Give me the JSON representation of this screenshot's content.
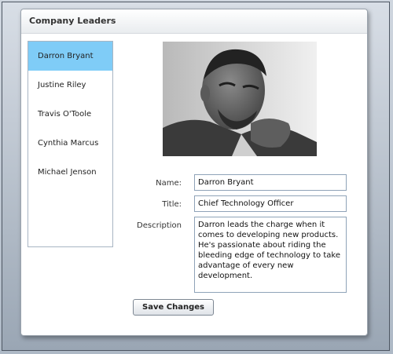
{
  "panel": {
    "title": "Company Leaders"
  },
  "leaders": [
    {
      "name": "Darron Bryant",
      "selected": true
    },
    {
      "name": "Justine Riley",
      "selected": false
    },
    {
      "name": "Travis O'Toole",
      "selected": false
    },
    {
      "name": "Cynthia Marcus",
      "selected": false
    },
    {
      "name": "Michael Jenson",
      "selected": false
    }
  ],
  "details": {
    "name_label": "Name:",
    "name_value": "Darron Bryant",
    "title_label": "Title:",
    "title_value": "Chief Technology Officer",
    "description_label": "Description",
    "description_value": "Darron leads the charge when it comes to developing new products. He's passionate about riding the bleeding edge of technology to take advantage of every new development."
  },
  "actions": {
    "save_label": "Save Changes"
  },
  "colors": {
    "selected_item": "#7fccf7",
    "field_border": "#8fa3b8"
  }
}
